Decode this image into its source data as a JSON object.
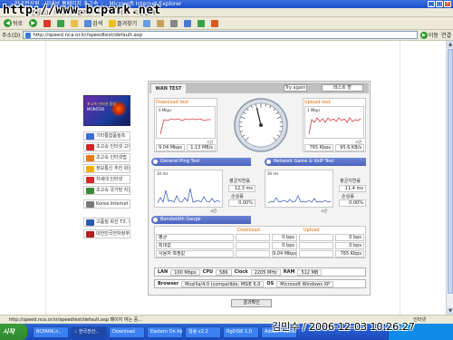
{
  "window": {
    "title": ":: 한국전산원 - 이네보 홈페이지 초고속 :: - Microsoft Internet Explorer",
    "controls": [
      "_",
      "□",
      "×"
    ]
  },
  "watermark": "http://www.bcpark.net",
  "menubar": {
    "items": [
      "편집(E)",
      "보기(V)",
      "즐겨찾기(A)",
      "도구(T)",
      "도움말(H)"
    ]
  },
  "toolbar": {
    "back_label": "뒤로",
    "search_label": "검색",
    "favorites_label": "즐겨찾기"
  },
  "addressbar": {
    "label": "주소(D)",
    "url": "http://speed.nca.or.kr/speedtest/default.asp",
    "go_label": "이동",
    "links_label": "연결"
  },
  "sidebar": {
    "banner_line1": "초고속 인터넷 품질",
    "banner_line2": "MONITOR",
    "items": [
      {
        "label": "기타통합품질측",
        "color": "#3b6bd6"
      },
      {
        "label": "초고속 인터넷 고객노트",
        "color": "#d0262a"
      },
      {
        "label": "초고속 인터넷법",
        "color": "#e87a1a"
      },
      {
        "label": "정보통신 추진 위원회",
        "color": "#f0b000"
      },
      {
        "label": "차세대 인터넷",
        "color": "#d8262a"
      },
      {
        "label": "초고속 국가망 지원 시스템",
        "color": "#3a8a3a"
      },
      {
        "label": "Korea Internet Exchange",
        "color": "#777777"
      },
      {
        "label": "고품질 회선 T3, 회선",
        "color": "#2c5cb0"
      },
      {
        "label": "대한민국전자정부",
        "color": "#b02020"
      }
    ]
  },
  "panel": {
    "tab_label": "WAN TEST",
    "try_again_label": "Try again",
    "restart_label": "테스트 할",
    "download": {
      "title": "Download test",
      "graph_label": "9 Mbps",
      "time_label": "시간",
      "speed_mbps": "9.04 Mbps",
      "speed_mbs": "1.13 MB/s"
    },
    "upload": {
      "title": "Upload test",
      "graph_label": "1 Mbps",
      "time_label": "시간",
      "speed_kbps": "765 Kbps",
      "speed_kbs": "95.6 KB/s"
    },
    "gauge_level": 0.45,
    "general_ping_label": "General Ping Test",
    "network_game_label": "Network Game & VoIP Test",
    "ping_left": {
      "graph_label": "30 ms",
      "time_label": "시간",
      "avg_label": "평균지연률",
      "avg_value": "12.3 ms",
      "loss_label": "손실률",
      "loss_value": "0.00%"
    },
    "ping_right": {
      "graph_label": "30 ms",
      "time_label": "시간",
      "avg_label": "평균지연률",
      "avg_value": "11.4 ms",
      "loss_label": "손실률",
      "loss_value": "0.00%"
    },
    "bandwidth_label": "Bandwidth Gauge",
    "bw_table": {
      "headers": [
        "",
        "",
        "Download",
        "",
        "Upload"
      ],
      "rows": [
        {
          "label": "평균",
          "d1": "",
          "d2": "0 bps",
          "u1": "",
          "u2": "0 bps"
        },
        {
          "label": "최대값",
          "d1": "",
          "d2": "0 bps",
          "u1": "",
          "u2": "0 bps"
        },
        {
          "label": "사용자 측정값",
          "d1": "",
          "d2": "9.04 Mbps",
          "u1": "",
          "u2": "765 Kbps"
        }
      ]
    },
    "sys": {
      "lan_label": "LAN",
      "lan_value": "100 Mbps",
      "cpu_label": "CPU",
      "cpu_value": "586",
      "clock_label": "Clock",
      "clock_value": "2205 MHz",
      "ram_label": "RAM",
      "ram_value": "512 MB",
      "browser_label": "Browser",
      "browser_value": "Mozilla/4.0 (compatible; MSIE 6.0",
      "os_label": "OS",
      "os_value": "Microsoft Windows XP"
    },
    "result_button_label": "결과확인"
  },
  "statusbar": {
    "text": "http://speed.nca.or.kr/speedtest/default.asp 페이지 여는 중...",
    "zone": "인터넷"
  },
  "taskbar": {
    "start_label": "시작",
    "tasks": [
      "BCPARK.n..",
      ":: 한국전산..",
      "Download",
      "Eastern On Air..",
      "알송 v2.2",
      "RgDISK 1.0",
      "Adobe Photo.."
    ],
    "active_index": 1
  },
  "timestamp": "김민수 / 2006-12-03 10:26:27"
}
